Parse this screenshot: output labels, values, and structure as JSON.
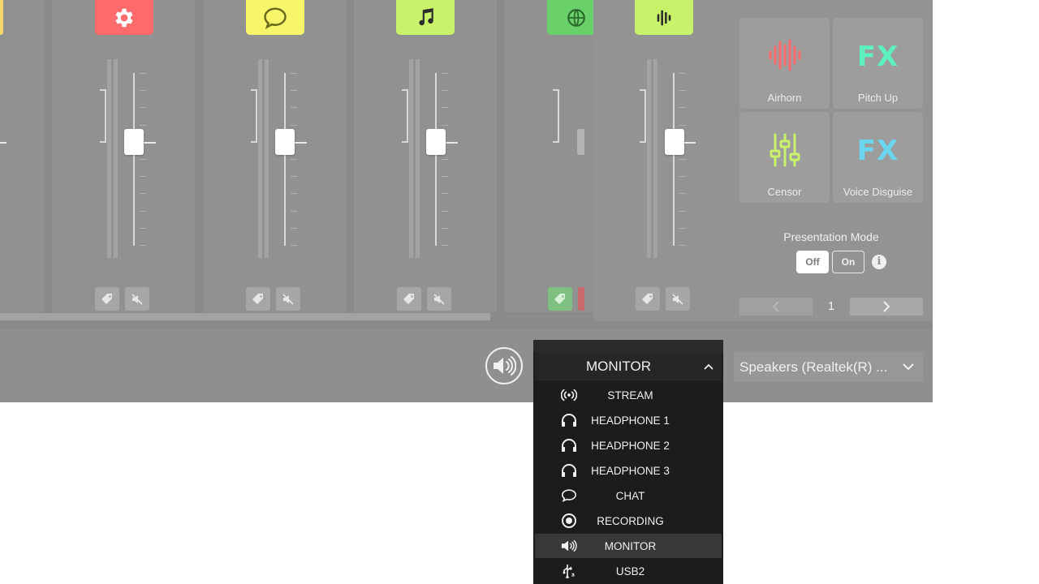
{
  "soundpads": [
    {
      "label": "Airhorn",
      "icon": "waveform-icon",
      "color": "#ff6b6b"
    },
    {
      "label": "Pitch Up",
      "icon_text": "FX",
      "color": "#5ef0c0"
    },
    {
      "label": "Censor",
      "icon": "equalizer-icon",
      "color": "#c8f26a"
    },
    {
      "label": "Voice Disguise",
      "icon_text": "FX",
      "color": "#6ad6f0"
    }
  ],
  "presentation_mode": {
    "label": "Presentation Mode",
    "off_label": "Off",
    "on_label": "On",
    "selected": "Off"
  },
  "pagination": {
    "page": "1"
  },
  "output_select": {
    "selected": "MONITOR",
    "options": [
      {
        "label": "STREAM",
        "icon": "broadcast-icon"
      },
      {
        "label": "HEADPHONE 1",
        "icon": "headphones-icon"
      },
      {
        "label": "HEADPHONE 2",
        "icon": "headphones-icon"
      },
      {
        "label": "HEADPHONE 3",
        "icon": "headphones-icon"
      },
      {
        "label": "CHAT",
        "icon": "chat-bubble-icon"
      },
      {
        "label": "RECORDING",
        "icon": "record-icon"
      },
      {
        "label": "MONITOR",
        "icon": "speaker-icon",
        "highlighted": true
      },
      {
        "label": "USB2",
        "icon": "usb-icon"
      }
    ]
  },
  "device_select": {
    "value": "Speakers (Realtek(R) ..."
  },
  "channels": [
    {
      "tile_color": "#ff6b6b",
      "icon": "gear-icon",
      "fader_level": 0.67
    },
    {
      "tile_color": "#f7f56a",
      "icon": "chat-bubble-icon",
      "fader_level": 0.67
    },
    {
      "tile_color": "#c8f26a",
      "icon": "music-note-icon",
      "fader_level": 0.67
    },
    {
      "tile_color": "#6ad06a",
      "icon": "globe-icon",
      "fader_level": 0.67
    },
    {
      "tile_color": "#c8f26a",
      "icon": "waveform-icon",
      "fader_level": 0.67
    }
  ]
}
